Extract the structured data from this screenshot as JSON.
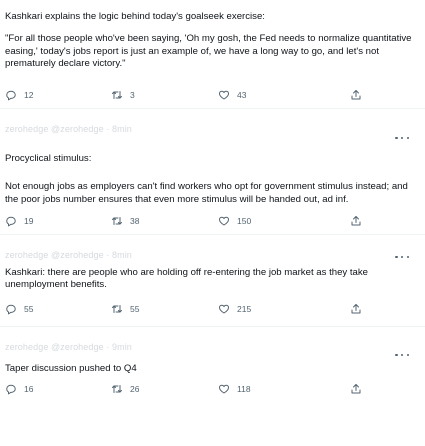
{
  "tweets": [
    {
      "paragraphs": [
        "Kashkari explains the logic behind today's goalseek exercise:",
        "\"For all those people who've been saying, 'Oh my gosh, the Fed needs to normalize quantitative easing,' today's jobs report is just an example of, we have a long way to go, and let's not prematurely declare victory.\""
      ],
      "replies": "12",
      "retweets": "3",
      "likes": "43"
    },
    {
      "header_ghost": "zerohedge @zerohedge · 8min",
      "paragraphs": [
        "Procyclical stimulus:",
        "Not enough jobs as employers can't find workers who opt for government stimulus instead; and the poor jobs number ensures that even more stimulus will be handed out, ad inf."
      ],
      "replies": "19",
      "retweets": "38",
      "likes": "150"
    },
    {
      "header_ghost": "zerohedge @zerohedge · 8min",
      "paragraphs": [
        "Kashkari: there are people who are holding off re-entering the job market as they take unemployment benefits."
      ],
      "replies": "55",
      "retweets": "55",
      "likes": "215"
    },
    {
      "header_ghost": "zerohedge @zerohedge · 9min",
      "paragraphs": [
        "Taper discussion pushed to Q4"
      ],
      "replies": "16",
      "retweets": "26",
      "likes": "118"
    }
  ],
  "icons": {
    "reply": "reply-icon",
    "retweet": "retweet-icon",
    "like": "heart-icon",
    "share": "share-icon",
    "more": "more-options-icon"
  },
  "colors": {
    "text": "#0f1419",
    "muted": "#536471",
    "divider": "#eff3f4"
  }
}
